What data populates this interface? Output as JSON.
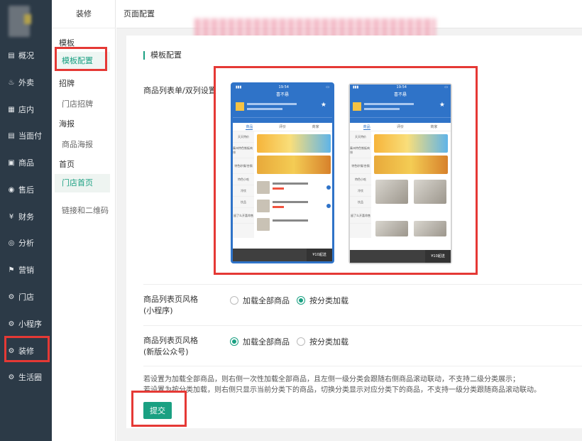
{
  "sidebar": {
    "items": [
      {
        "label": "概况",
        "icon": "chart-icon",
        "glyph": "▤"
      },
      {
        "label": "外卖",
        "icon": "scooter-icon",
        "glyph": "♨"
      },
      {
        "label": "店内",
        "icon": "store-icon",
        "glyph": "▦"
      },
      {
        "label": "当面付",
        "icon": "receipt-icon",
        "glyph": "▤"
      },
      {
        "label": "商品",
        "icon": "bag-icon",
        "glyph": "▣"
      },
      {
        "label": "售后",
        "icon": "aftersale-icon",
        "glyph": "◉"
      },
      {
        "label": "财务",
        "icon": "yen-icon",
        "glyph": "¥"
      },
      {
        "label": "分析",
        "icon": "analysis-icon",
        "glyph": "◎"
      },
      {
        "label": "营销",
        "icon": "flag-icon",
        "glyph": "⚑"
      },
      {
        "label": "门店",
        "icon": "gear-icon",
        "glyph": "⚙"
      },
      {
        "label": "小程序",
        "icon": "gear-icon",
        "glyph": "⚙"
      },
      {
        "label": "装修",
        "icon": "gear-icon",
        "glyph": "⚙"
      },
      {
        "label": "生活圈",
        "icon": "gear-icon",
        "glyph": "⚙"
      }
    ]
  },
  "subnav": {
    "title": "装修",
    "groups": {
      "template": "模板",
      "template_config": "模板配置",
      "recruit": "招牌",
      "store_sign": "门店招牌",
      "poster": "海报",
      "product_poster": "商品海报",
      "home": "首页",
      "store_home": "门店首页",
      "links": "链接和二维码"
    }
  },
  "header": {
    "title": "页面配置"
  },
  "main": {
    "section_title": "模板配置",
    "layout_label": "商品列表单/双列设置",
    "phone": {
      "time": "19:54",
      "shop_name": "喜不悬",
      "tabs": [
        "商品",
        "评价",
        "商家"
      ],
      "categories": [
        "天天特价",
        "秦州特色铁板肉排",
        "特色砂锅/合锅",
        "特色小吃",
        "冷饮",
        "饮品",
        "留了么开喜命售"
      ],
      "cart_label": "¥10起送"
    },
    "list_style_miniprogram": {
      "label_line1": "商品列表页风格",
      "label_line2": "(小程序)",
      "options": [
        "加载全部商品",
        "按分类加载"
      ],
      "selected": 1
    },
    "list_style_official": {
      "label_line1": "商品列表页风格",
      "label_line2": "(新版公众号)",
      "options": [
        "加载全部商品",
        "按分类加载"
      ],
      "selected": 0
    },
    "note_line1": "若设置为加载全部商品，则右侧一次性加载全部商品，且左侧一级分类会跟随右侧商品滚动联动，不支持二级分类展示；",
    "note_line2": "若设置为按分类加载，则右侧只显示当前分类下的商品，切换分类显示对应分类下的商品，不支持一级分类跟随商品滚动联动。",
    "submit_label": "提交"
  },
  "colors": {
    "accent": "#1aa082",
    "sidebar_bg": "#2c3a47",
    "highlight": "#e53935",
    "phone_blue": "#2f73c8"
  }
}
